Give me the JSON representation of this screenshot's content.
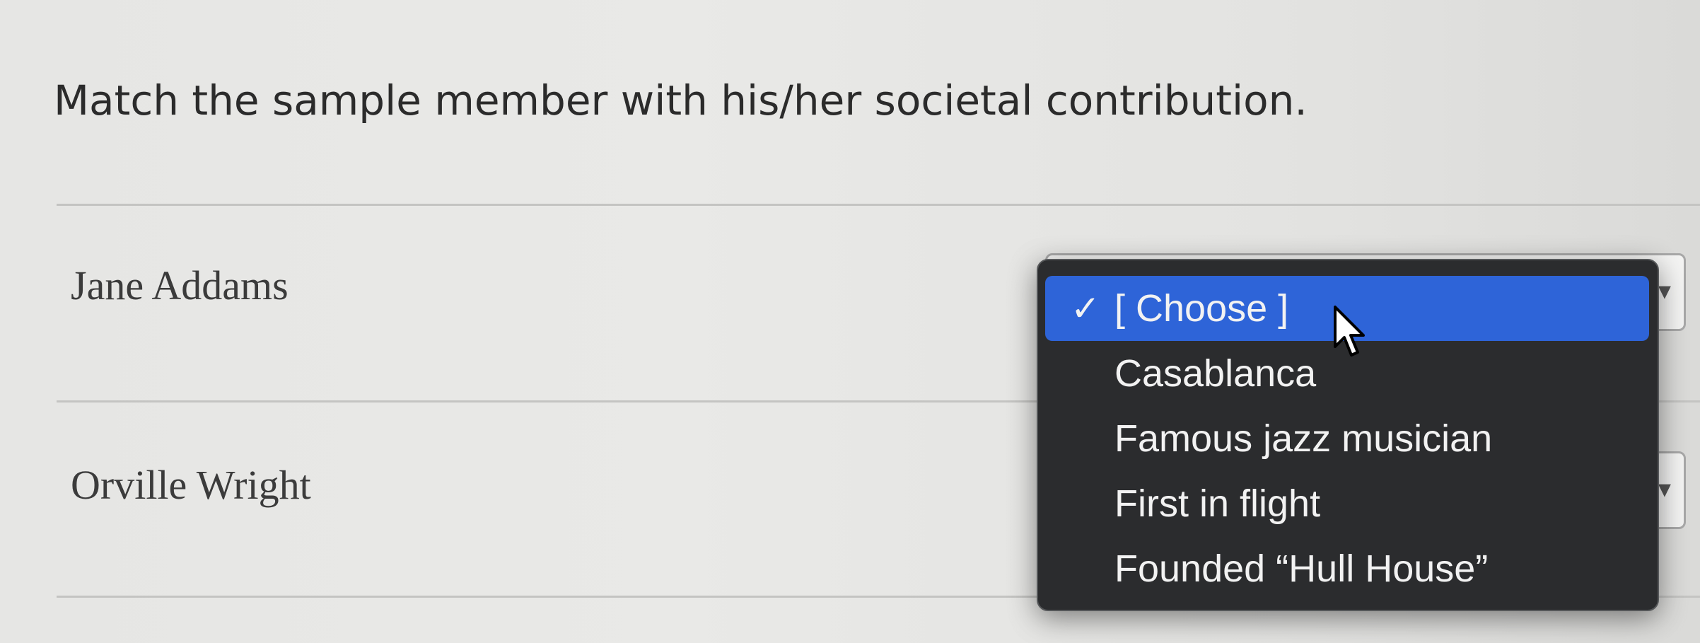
{
  "question": {
    "prompt": "Match the sample member with his/her societal contribution."
  },
  "rows": [
    {
      "label": "Jane Addams",
      "selected": "[ Choose ]"
    },
    {
      "label": "Orville Wright",
      "selected": "[ Choose ]"
    }
  ],
  "dropdown": {
    "options": [
      {
        "label": "[ Choose ]",
        "checked": true,
        "check_mark": "✓"
      },
      {
        "label": "Casablanca",
        "checked": false
      },
      {
        "label": "Famous jazz musician",
        "checked": false
      },
      {
        "label": "First in flight",
        "checked": false
      },
      {
        "label": "Founded “Hull House”",
        "checked": false
      }
    ],
    "highlight_color": "#2e64d8",
    "background_color": "#2b2c2e"
  },
  "icons": {
    "check": "checkmark-icon",
    "cursor": "mouse-pointer-icon",
    "chevron": "chevron-icon"
  }
}
